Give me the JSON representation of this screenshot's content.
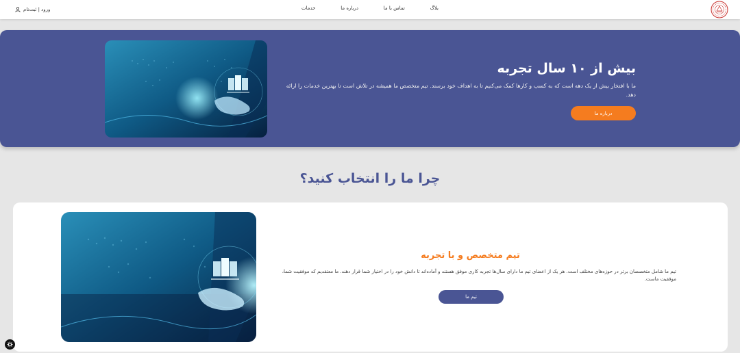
{
  "header": {
    "login_label": "ورود | ثبت‌نام",
    "user_icon": "user-icon",
    "nav": [
      {
        "label": "خدمات"
      },
      {
        "label": "درباره ما"
      },
      {
        "label": "تماس با ما"
      },
      {
        "label": "بلاگ"
      }
    ],
    "logo_icon": "seal-logo"
  },
  "hero": {
    "title": "بیش از ۱۰ سال تجربه",
    "description": "ما با افتخار بیش از یک دهه است که به کسب و کارها کمک می‌کنیم تا به اهداف خود برسند. تیم متخصص ما همیشه در تلاش است تا بهترین خدمات را ارائه دهد.",
    "button_label": "درباره ما",
    "image_icon": "cloud-server-hand-illustration"
  },
  "why": {
    "title": "چرا ما را انتخاب کنید؟",
    "card": {
      "title": "تیم متخصص و با تجربه",
      "description": "تیم ما شامل متخصصان برتر در حوزه‌های مختلف است. هر یک از اعضای تیم ما دارای سال‌ها تجربه کاری موفق هستند و آماده‌اند تا دانش خود را در اختیار شما قرار دهند. ما معتقدیم که موفقیت شما، موفقیت ماست.",
      "button_label": "تیم ما",
      "image_icon": "cloud-server-hand-illustration"
    }
  },
  "colors": {
    "primary": "#4a5594",
    "accent": "#f57c1f",
    "background": "#e6e6e6"
  }
}
